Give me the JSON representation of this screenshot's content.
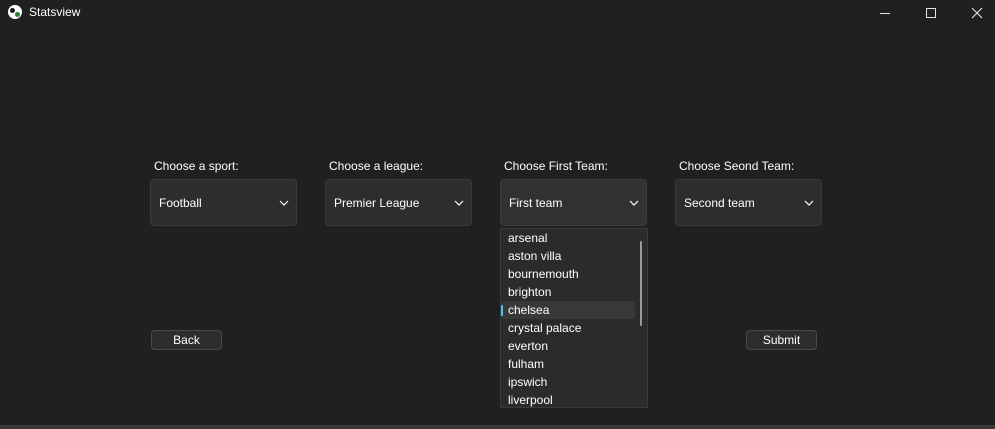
{
  "window": {
    "title": "Statsview",
    "minimize_label": "",
    "maximize_label": "",
    "close_label": "✕"
  },
  "form": {
    "sport": {
      "label": "Choose a sport:",
      "value": "Football"
    },
    "league": {
      "label": "Choose a league:",
      "value": "Premier League"
    },
    "first_team": {
      "label": "Choose First Team:",
      "value": "First team"
    },
    "second_team": {
      "label": "Choose Seond Team:",
      "value": "Second team"
    }
  },
  "dropdown": {
    "items": [
      "arsenal",
      "aston villa",
      "bournemouth",
      "brighton",
      "chelsea",
      "crystal palace",
      "everton",
      "fulham",
      "ipswich",
      "liverpool"
    ],
    "highlighted": "chelsea"
  },
  "buttons": {
    "back": "Back",
    "submit": "Submit"
  },
  "colors": {
    "background": "#202020",
    "control": "#2d2d2d",
    "accent": "#4cc2ff"
  }
}
